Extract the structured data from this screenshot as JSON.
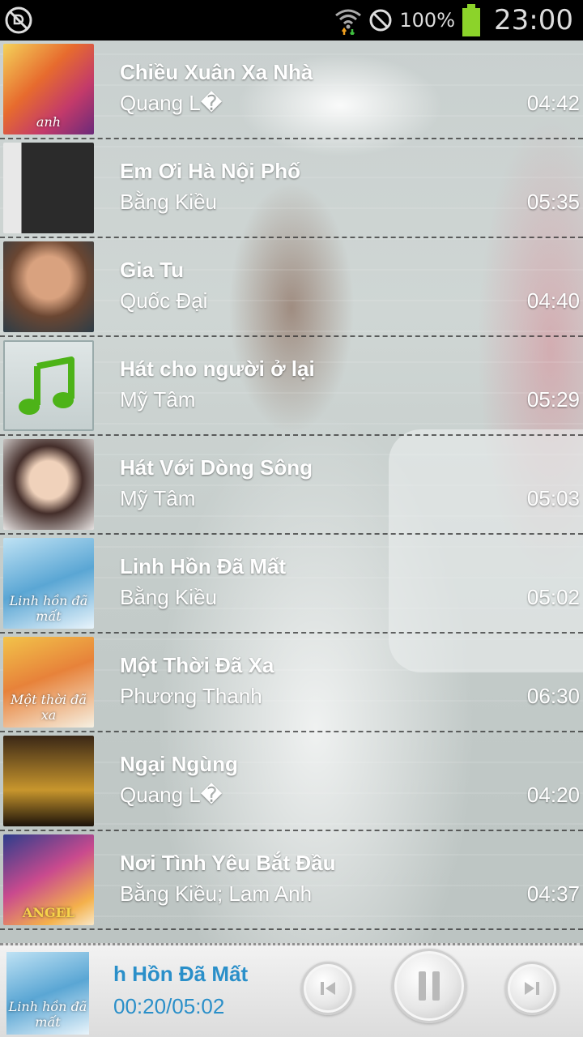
{
  "status_bar": {
    "battery_percent": "100%",
    "clock": "23:00",
    "icons": [
      "no-signal-icon",
      "wifi-icon",
      "blocked-icon",
      "battery-icon"
    ],
    "battery_color": "#8cd32a"
  },
  "songs": [
    {
      "title": "Chiều Xuân Xa Nhà",
      "artist": "Quang L�",
      "duration": "04:42",
      "art_label": "anh"
    },
    {
      "title": "Em Ơi Hà Nội Phố",
      "artist": "Bằng Kiều",
      "duration": "05:35",
      "art_label": ""
    },
    {
      "title": "Gia Tu",
      "artist": "Quốc Đại",
      "duration": "04:40",
      "art_label": ""
    },
    {
      "title": "Hát cho người ở lại",
      "artist": "Mỹ Tâm",
      "duration": "05:29",
      "art_label": ""
    },
    {
      "title": "Hát Với Dòng Sông",
      "artist": "Mỹ Tâm",
      "duration": "05:03",
      "art_label": ""
    },
    {
      "title": "Linh Hồn Đã Mất",
      "artist": "Bằng Kiều",
      "duration": "05:02",
      "art_label": "Linh hồn đã mất"
    },
    {
      "title": "Một Thời Đã Xa",
      "artist": "Phương Thanh",
      "duration": "06:30",
      "art_label": "Một thời đã xa"
    },
    {
      "title": "Ngại Ngùng",
      "artist": "Quang L�",
      "duration": "04:20",
      "art_label": ""
    },
    {
      "title": "Nơi Tình Yêu Bắt Đầu",
      "artist": "Bằng Kiều; Lam Anh",
      "duration": "04:37",
      "art_label": "ANGEL"
    }
  ],
  "now_playing": {
    "title_visible": "h Hồn Đã Mất",
    "time": "00:20/05:02",
    "art_label": "Linh hồn đã mất",
    "accent_color": "#2a8fc9"
  },
  "controls": {
    "prev_icon": "skip-previous-icon",
    "pause_icon": "pause-icon",
    "next_icon": "skip-next-icon"
  }
}
